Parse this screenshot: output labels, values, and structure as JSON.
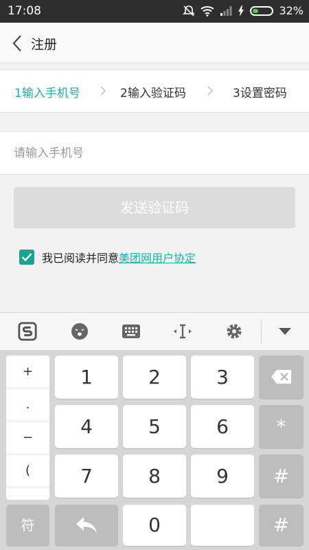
{
  "status_bar": {
    "time": "17:08",
    "battery": "32%",
    "battery_level": 0.32,
    "icons": [
      "bell-off-icon",
      "wifi-icon",
      "signal-icon",
      "charging-icon",
      "battery-icon"
    ]
  },
  "header": {
    "title": "注册",
    "back_icon": "chevron-left-icon"
  },
  "steps": [
    {
      "label": "1输入手机号",
      "active": true
    },
    {
      "label": "2输入验证码",
      "active": false
    },
    {
      "label": "3设置密码",
      "active": false
    }
  ],
  "phone_input": {
    "placeholder": "请输入手机号",
    "value": ""
  },
  "send_button": {
    "label": "发送验证码"
  },
  "agreement": {
    "checked": true,
    "text": "我已阅读并同意",
    "link": "美团网用户协定"
  },
  "ime_toolbar": {
    "icons": [
      "sogou-logo-icon",
      "emoji-icon",
      "keyboard-icon",
      "cursor-icon",
      "gear-icon",
      "collapse-down-icon"
    ]
  },
  "keyboard": {
    "symbols": [
      "+",
      ".",
      "−",
      "(",
      "、"
    ],
    "digits": [
      "1",
      "2",
      "3",
      "4",
      "5",
      "6",
      "7",
      "8",
      "9",
      "0"
    ],
    "backspace_icon": "backspace-icon",
    "star": "*",
    "hash": "#",
    "fu": "符",
    "return_icon": "return-arrow-icon",
    "hash2": "#"
  },
  "colors": {
    "accent": "#19b5a3",
    "checkbox": "#19a48f",
    "statusbar": "#2e2e2e"
  }
}
